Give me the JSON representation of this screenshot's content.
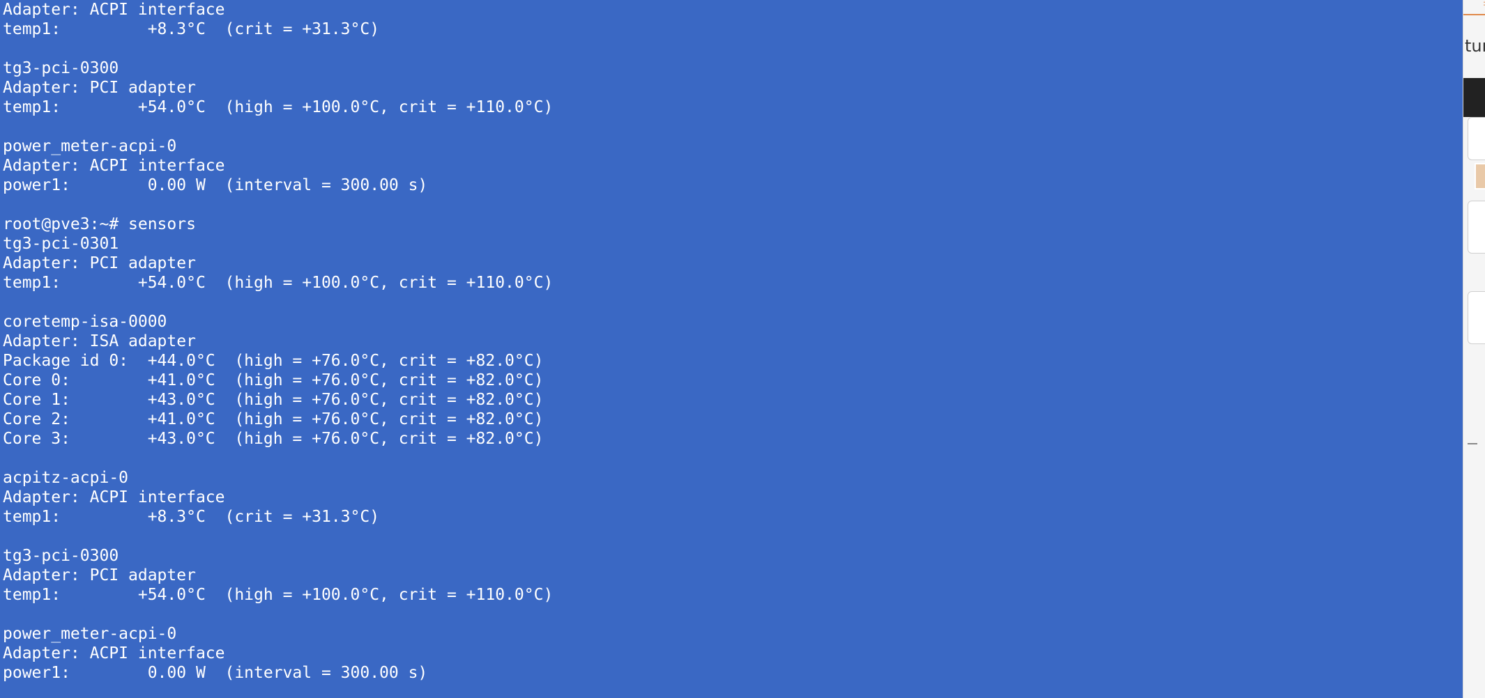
{
  "terminal": {
    "lines": [
      "Adapter: ACPI interface",
      "temp1:         +8.3°C  (crit = +31.3°C)",
      "",
      "tg3-pci-0300",
      "Adapter: PCI adapter",
      "temp1:        +54.0°C  (high = +100.0°C, crit = +110.0°C)",
      "",
      "power_meter-acpi-0",
      "Adapter: ACPI interface",
      "power1:        0.00 W  (interval = 300.00 s)",
      "",
      "root@pve3:~# sensors",
      "tg3-pci-0301",
      "Adapter: PCI adapter",
      "temp1:        +54.0°C  (high = +100.0°C, crit = +110.0°C)",
      "",
      "coretemp-isa-0000",
      "Adapter: ISA adapter",
      "Package id 0:  +44.0°C  (high = +76.0°C, crit = +82.0°C)",
      "Core 0:        +41.0°C  (high = +76.0°C, crit = +82.0°C)",
      "Core 1:        +43.0°C  (high = +76.0°C, crit = +82.0°C)",
      "Core 2:        +41.0°C  (high = +76.0°C, crit = +82.0°C)",
      "Core 3:        +43.0°C  (high = +76.0°C, crit = +82.0°C)",
      "",
      "acpitz-acpi-0",
      "Adapter: ACPI interface",
      "temp1:         +8.3°C  (crit = +31.3°C)",
      "",
      "tg3-pci-0300",
      "Adapter: PCI adapter",
      "temp1:        +54.0°C  (high = +100.0°C, crit = +110.0°C)",
      "",
      "power_meter-acpi-0",
      "Adapter: ACPI interface",
      "power1:        0.00 W  (interval = 300.00 s)"
    ],
    "background_color": "#3a68c4",
    "text_color": "#ffffff"
  },
  "right_window": {
    "partial_text": "tura"
  }
}
